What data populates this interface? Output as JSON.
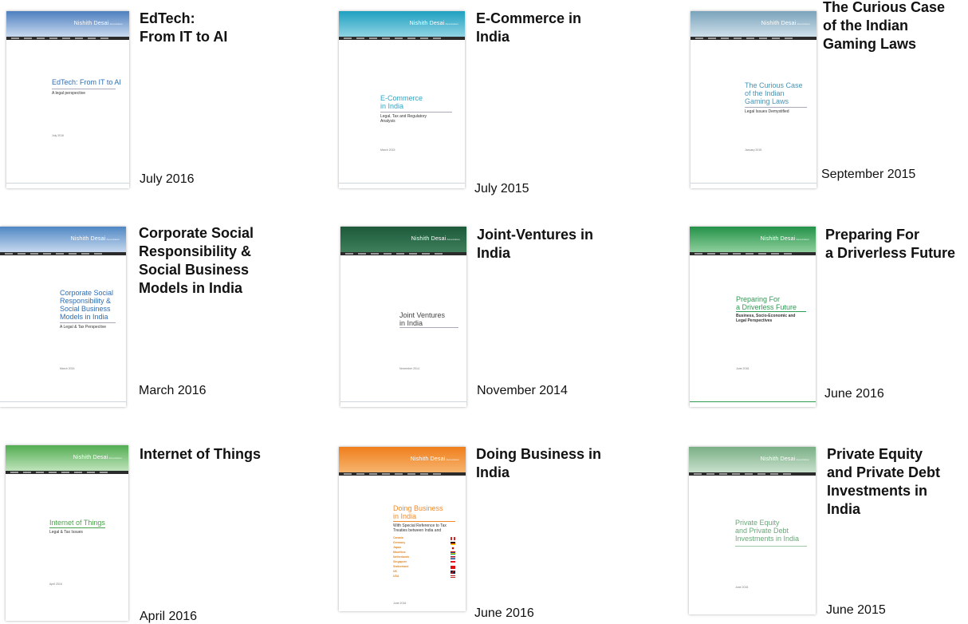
{
  "publications": [
    {
      "title": "EdTech:\nFrom IT to AI",
      "date": "July 2016",
      "cover": {
        "brand": "Nishith Desai",
        "brand_suffix": "Associates",
        "title": "EdTech: From IT to AI",
        "subtitle": "A legal perspective",
        "date": "July 2016",
        "band_color": "#5a8cc6",
        "title_color": "#2f6db3"
      }
    },
    {
      "title": "E-Commerce in\nIndia",
      "date": "July 2015",
      "cover": {
        "brand": "Nishith Desai",
        "brand_suffix": "Associates",
        "title": "E-Commerce\nin India",
        "subtitle": "Legal, Tax and Regulatory\nAnalysis",
        "date": "March 2015",
        "band_color": "#2fa6c4",
        "title_color": "#2fa6c4"
      }
    },
    {
      "title": "The Curious Case\nof the Indian\nGaming Laws",
      "date": "September 2015",
      "cover": {
        "brand": "Nishith Desai",
        "brand_suffix": "Associates",
        "title": "The Curious Case\nof the Indian\nGaming Laws",
        "subtitle": "Legal Issues Demystified",
        "date": "January 2015",
        "band_color": "#7fa8bf",
        "title_color": "#4a93b5"
      }
    },
    {
      "title": "Corporate Social\nResponsibility &\nSocial Business\nModels in India",
      "date": "March 2016",
      "cover": {
        "brand": "Nishith Desai",
        "brand_suffix": "Associates",
        "title": "Corporate Social\nResponsibility &\nSocial Business\nModels in India",
        "subtitle": "A Legal & Tax Perspective",
        "date": "March 2015",
        "band_color": "#4f87c4",
        "title_color": "#2f6db3"
      }
    },
    {
      "title": "Joint-Ventures in\nIndia",
      "date": "November 2014",
      "cover": {
        "brand": "Nishith Desai",
        "brand_suffix": "Associates",
        "title": "Joint Ventures\nin India",
        "subtitle": "",
        "date": "November 2014",
        "band_color": "#1e5e3e",
        "title_color": "#444444"
      }
    },
    {
      "title": "Preparing For\na Driverless Future",
      "date": "June 2016",
      "cover": {
        "brand": "Nishith Desai",
        "brand_suffix": "Associates",
        "title": "Preparing For\na Driverless Future",
        "subtitle": "Business, Socio-Economic and\nLegal Perspectives",
        "date": "June 2016",
        "band_color": "#2e9a52",
        "title_color": "#2e9a52"
      }
    },
    {
      "title": "Internet of Things",
      "date": "April 2016",
      "cover": {
        "brand": "Nishith Desai",
        "brand_suffix": "Associates",
        "title": "Internet of Things",
        "subtitle": "Legal & Tax Issues",
        "date": "April 2016",
        "band_color": "#5fb55a",
        "title_color": "#4aa34a"
      }
    },
    {
      "title": "Doing Business in\nIndia",
      "date": "June 2016",
      "cover": {
        "brand": "Nishith Desai",
        "brand_suffix": "Associates",
        "title": "Doing Business\nin India",
        "subtitle": "With Special Reference to Tax\nTreaties between India and",
        "date": "June 2016",
        "band_color": "#f08a2c",
        "title_color": "#f08a2c",
        "countries": [
          "Canada",
          "Germany",
          "Japan",
          "Mauritius",
          "Netherlands",
          "Singapore",
          "Switzerland",
          "UK",
          "USA"
        ]
      }
    },
    {
      "title": "Private Equity\nand Private Debt\nInvestments in\nIndia",
      "date": "June 2015",
      "cover": {
        "brand": "Nishith Desai",
        "brand_suffix": "Associates",
        "title": "Private Equity\nand Private Debt\nInvestments in India",
        "subtitle": "",
        "date": "June 2015",
        "band_color": "#7fb38a",
        "title_color": "#6aa879"
      }
    }
  ]
}
